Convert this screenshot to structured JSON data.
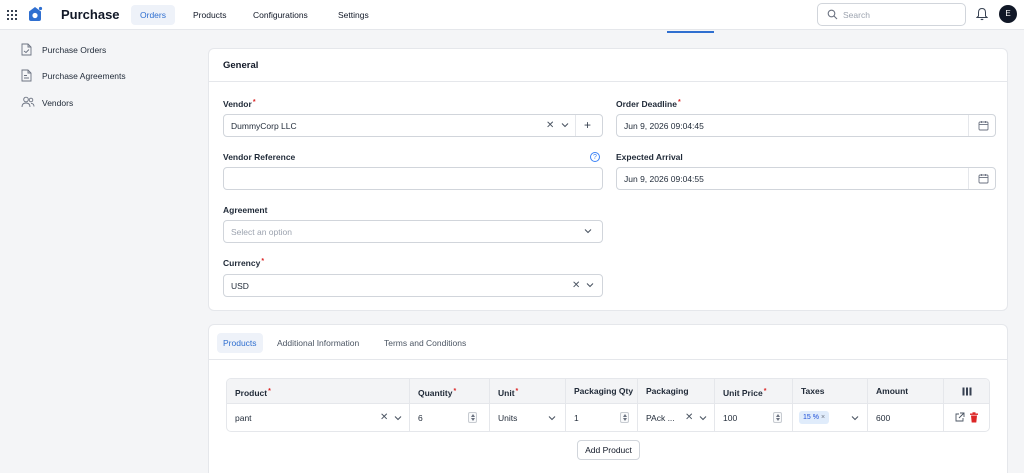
{
  "app": {
    "title": "Purchase",
    "avatar_initial": "E"
  },
  "nav": {
    "orders": "Orders",
    "products": "Products",
    "configurations": "Configurations",
    "settings": "Settings"
  },
  "search": {
    "placeholder": "Search"
  },
  "sidebar": {
    "items": [
      {
        "label": "Purchase Orders"
      },
      {
        "label": "Purchase Agreements"
      },
      {
        "label": "Vendors"
      }
    ]
  },
  "general": {
    "title": "General",
    "vendor": {
      "label": "Vendor",
      "value": "DummyCorp LLC"
    },
    "vendor_reference": {
      "label": "Vendor Reference",
      "value": ""
    },
    "agreement": {
      "label": "Agreement",
      "placeholder": "Select an option"
    },
    "currency": {
      "label": "Currency",
      "value": "USD"
    },
    "order_deadline": {
      "label": "Order Deadline",
      "value": "Jun 9, 2026 09:04:45"
    },
    "expected_arrival": {
      "label": "Expected Arrival",
      "value": "Jun 9, 2026 09:04:55"
    },
    "required_marker": "*",
    "help_glyph": "?"
  },
  "tabs": {
    "products": "Products",
    "additional": "Additional Information",
    "terms": "Terms and Conditions"
  },
  "table": {
    "headers": {
      "product": "Product",
      "quantity": "Quantity",
      "unit": "Unit",
      "packaging_qty": "Packaging Qty",
      "packaging": "Packaging",
      "unit_price": "Unit Price",
      "taxes": "Taxes",
      "amount": "Amount"
    },
    "rows": [
      {
        "product": "pant",
        "quantity": "6",
        "unit": "Units",
        "packaging_qty": "1",
        "packaging": "PAck ...",
        "unit_price": "100",
        "tax": "15 %",
        "amount": "600"
      }
    ]
  },
  "add_product_label": "Add Product",
  "colors": {
    "accent": "#2f6fd0",
    "danger": "#dc2626",
    "required": "#dc2626"
  }
}
